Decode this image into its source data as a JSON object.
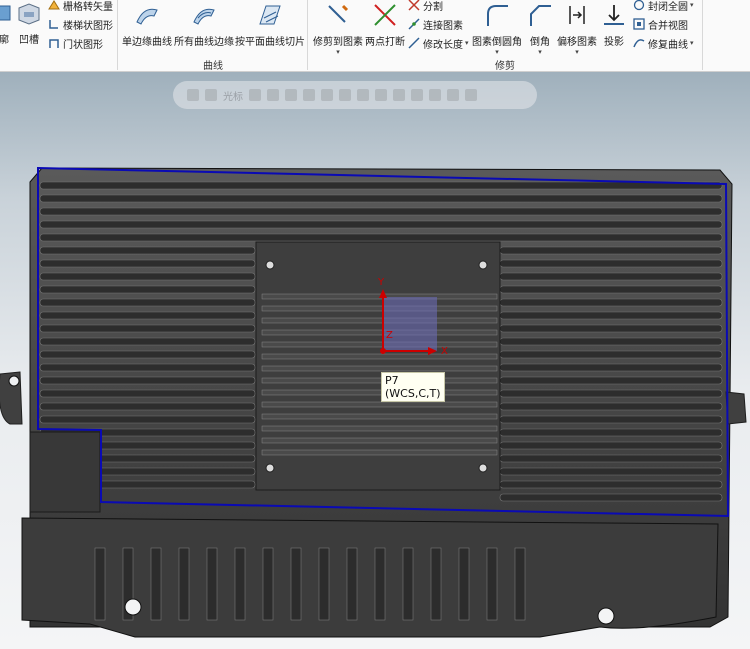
{
  "ribbon": {
    "left_group": {
      "grid_vector": "栅格转矢量",
      "ladder_shape": "楼梯状图形",
      "door_shape": "门状图形",
      "profile_partial": "廓",
      "groove": "凹槽"
    },
    "curve_group": {
      "label": "曲线",
      "single_edge_curve": "单边缘曲线",
      "all_curve_edges": "所有曲线边缘",
      "plane_curve_slice": "按平面曲线切片"
    },
    "modify_group": {
      "label": "修剪",
      "trim_to_element": "修剪到图素",
      "two_point_break": "两点打断",
      "split": "分割",
      "join_elements": "连接图素",
      "modify_length": "修改长度",
      "element_fillet": "图素倒圆角",
      "chamfer": "倒角",
      "offset_element": "偏移图素",
      "project": "投影",
      "close_all": "封闭全圆",
      "merge_view": "合并视图",
      "repair_curve": "修复曲线"
    }
  },
  "float_toolbar": {
    "cursor_label": "光标"
  },
  "viewport": {
    "tooltip_line1": "P7",
    "tooltip_line2": "(WCS,C,T)",
    "axis_x": "X",
    "axis_y": "Y",
    "axis_z": "Z"
  },
  "colors": {
    "selection_outline": "#0a0ab4",
    "model_body": "#3b3b3b",
    "axis_red": "#cc0000"
  }
}
